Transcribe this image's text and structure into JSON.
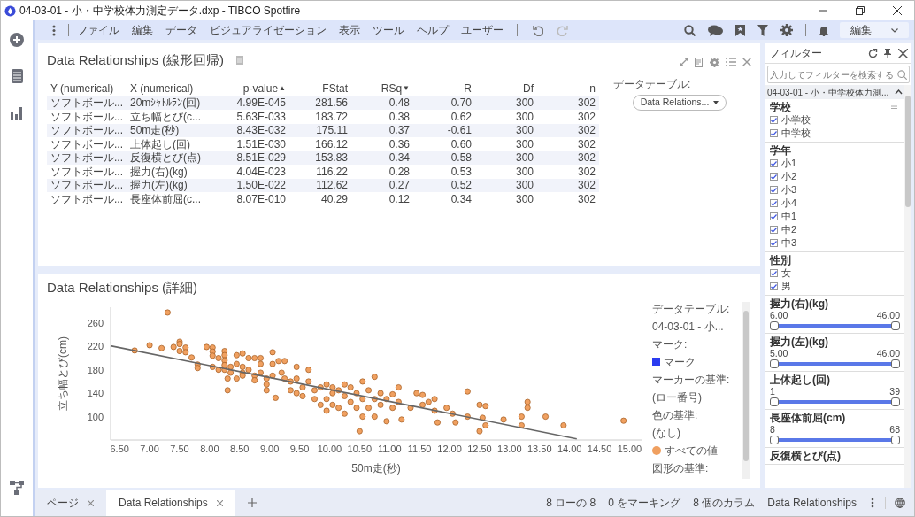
{
  "window": {
    "title": "04-03-01 - 小・中学校体力測定データ.dxp - TIBCO Spotfire"
  },
  "menu": {
    "items": [
      "ファイル",
      "編集",
      "データ",
      "ビジュアライゼーション",
      "表示",
      "ツール",
      "ヘルプ",
      "ユーザー"
    ],
    "mode": "編集"
  },
  "table_panel": {
    "title": "Data Relationships (線形回帰)",
    "data_table_label": "データテーブル:",
    "data_table_value": "Data Relations...",
    "columns": [
      {
        "label": "Y (numerical)"
      },
      {
        "label": "X (numerical)"
      },
      {
        "label": "p-value",
        "sort_mark": "▲"
      },
      {
        "label": "FStat"
      },
      {
        "label": "RSq",
        "sort_mark": "▼"
      },
      {
        "label": "R"
      },
      {
        "label": "Df"
      },
      {
        "label": "n"
      }
    ],
    "rows": [
      [
        "ソフトボール...",
        "20mｼｬﾄﾙﾗﾝ(回)",
        "4.99E-045",
        "281.56",
        "0.48",
        "0.70",
        "300",
        "302"
      ],
      [
        "ソフトボール...",
        "立ち幅とび(c...",
        "5.63E-033",
        "183.72",
        "0.38",
        "0.62",
        "300",
        "302"
      ],
      [
        "ソフトボール...",
        "50m走(秒)",
        "8.43E-032",
        "175.11",
        "0.37",
        "-0.61",
        "300",
        "302"
      ],
      [
        "ソフトボール...",
        "上体起し(回)",
        "1.51E-030",
        "166.12",
        "0.36",
        "0.60",
        "300",
        "302"
      ],
      [
        "ソフトボール...",
        "反復横とび(点)",
        "8.51E-029",
        "153.83",
        "0.34",
        "0.58",
        "300",
        "302"
      ],
      [
        "ソフトボール...",
        "握力(右)(kg)",
        "4.04E-023",
        "116.22",
        "0.28",
        "0.53",
        "300",
        "302"
      ],
      [
        "ソフトボール...",
        "握力(左)(kg)",
        "1.50E-022",
        "112.62",
        "0.27",
        "0.52",
        "300",
        "302"
      ],
      [
        "ソフトボール...",
        "長座体前屈(c...",
        "8.07E-010",
        "40.29",
        "0.12",
        "0.34",
        "300",
        "302"
      ]
    ]
  },
  "chart_panel": {
    "title": "Data Relationships (詳細)",
    "chart_data": {
      "type": "scatter",
      "xlabel": "50m走(秒)",
      "ylabel": "立ち幅とび(cm)",
      "xlim": [
        6.35,
        15.2
      ],
      "ylim": [
        60,
        287
      ],
      "xticks": [
        {
          "value": 6.5,
          "label": "6.50"
        },
        {
          "value": 7,
          "label": "7.00"
        },
        {
          "value": 7.5,
          "label": "7.50"
        },
        {
          "value": 8,
          "label": "8.00"
        },
        {
          "value": 8.5,
          "label": "8.50"
        },
        {
          "value": 9,
          "label": "9.00"
        },
        {
          "value": 9.5,
          "label": "9.50"
        },
        {
          "value": 10,
          "label": "10.00"
        },
        {
          "value": 10.5,
          "label": "10.50"
        },
        {
          "value": 11,
          "label": "11.00"
        },
        {
          "value": 11.5,
          "label": "11.50"
        },
        {
          "value": 12,
          "label": "12.00"
        },
        {
          "value": 12.5,
          "label": "12.50"
        },
        {
          "value": 13,
          "label": "13.00"
        },
        {
          "value": 13.5,
          "label": "13.50"
        },
        {
          "value": 14,
          "label": "14.00"
        },
        {
          "value": 14.5,
          "label": "14.50"
        },
        {
          "value": 15,
          "label": "15.00"
        }
      ],
      "yticks": [
        100,
        140,
        180,
        220,
        260
      ],
      "x": [
        6.75,
        7.0,
        7.2,
        7.3,
        7.4,
        7.5,
        7.5,
        7.5,
        7.6,
        7.6,
        7.7,
        7.8,
        7.8,
        7.95,
        8.05,
        8.05,
        8.05,
        8.05,
        8.15,
        8.15,
        8.25,
        8.25,
        8.25,
        8.25,
        8.25,
        8.3,
        8.3,
        8.35,
        8.35,
        8.45,
        8.45,
        8.45,
        8.55,
        8.55,
        8.55,
        8.55,
        8.65,
        8.65,
        8.75,
        8.75,
        8.75,
        8.85,
        8.85,
        8.85,
        8.95,
        8.95,
        8.95,
        9.05,
        9.05,
        9.05,
        9.1,
        9.15,
        9.2,
        9.25,
        9.25,
        9.35,
        9.35,
        9.45,
        9.45,
        9.45,
        9.55,
        9.55,
        9.65,
        9.65,
        9.75,
        9.75,
        9.85,
        9.85,
        9.95,
        9.95,
        9.95,
        10.05,
        10.05,
        10.05,
        10.15,
        10.15,
        10.25,
        10.25,
        10.25,
        10.35,
        10.35,
        10.45,
        10.45,
        10.5,
        10.55,
        10.55,
        10.55,
        10.65,
        10.65,
        10.75,
        10.75,
        10.75,
        10.85,
        10.85,
        10.95,
        10.95,
        11.05,
        11.05,
        11.15,
        11.15,
        11.2,
        11.35,
        11.45,
        11.55,
        11.55,
        11.65,
        11.75,
        11.75,
        11.8,
        11.95,
        12.05,
        12.1,
        12.3,
        12.3,
        12.5,
        12.5,
        12.55,
        12.6,
        12.6,
        12.9,
        13.2,
        13.2,
        13.3,
        13.3,
        13.6,
        13.9,
        14.9,
        6.35,
        14.12
      ],
      "series": [
        {
          "name": "すべての値",
          "color": "#f0a060",
          "values": [
            213,
            222,
            217,
            278,
            219,
            228,
            224,
            212,
            218,
            210,
            201,
            189,
            183,
            219,
            218,
            211,
            204,
            185,
            200,
            180,
            212,
            205,
            196,
            188,
            180,
            145,
            165,
            185,
            175,
            205,
            190,
            165,
            208,
            185,
            175,
            170,
            200,
            180,
            200,
            170,
            162,
            200,
            190,
            175,
            165,
            155,
            145,
            210,
            190,
            170,
            132,
            195,
            175,
            195,
            165,
            160,
            145,
            185,
            165,
            140,
            150,
            135,
            180,
            160,
            145,
            130,
            150,
            120,
            155,
            130,
            110,
            150,
            140,
            120,
            145,
            115,
            155,
            135,
            105,
            150,
            125,
            140,
            115,
            75,
            160,
            130,
            100,
            145,
            115,
            168,
            130,
            100,
            140,
            120,
            130,
            92,
            138,
            115,
            150,
            125,
            95,
            115,
            140,
            137,
            120,
            125,
            130,
            110,
            90,
            115,
            105,
            90,
            143,
            100,
            120,
            75,
            98,
            85,
            118,
            95,
            100,
            85,
            125,
            115,
            100,
            85,
            93,
            null,
            null
          ]
        },
        {
          "type": "line",
          "color": "#666666",
          "values": [
            null,
            null,
            null,
            null,
            null,
            null,
            null,
            null,
            null,
            null,
            null,
            null,
            null,
            null,
            null,
            null,
            null,
            null,
            null,
            null,
            null,
            null,
            null,
            null,
            null,
            null,
            null,
            null,
            null,
            null,
            null,
            null,
            null,
            null,
            null,
            null,
            null,
            null,
            null,
            null,
            null,
            null,
            null,
            null,
            null,
            null,
            null,
            null,
            null,
            null,
            null,
            null,
            null,
            null,
            null,
            null,
            null,
            null,
            null,
            null,
            null,
            null,
            null,
            null,
            null,
            null,
            null,
            null,
            null,
            null,
            null,
            null,
            null,
            null,
            null,
            null,
            null,
            null,
            null,
            null,
            null,
            null,
            null,
            null,
            null,
            null,
            null,
            null,
            null,
            null,
            null,
            null,
            null,
            null,
            null,
            null,
            null,
            null,
            null,
            null,
            null,
            null,
            null,
            null,
            null,
            null,
            null,
            null,
            null,
            null,
            null,
            null,
            null,
            null,
            null,
            null,
            null,
            null,
            null,
            null,
            null,
            null,
            null,
            null,
            null,
            null,
            null,
            221,
            62
          ]
        }
      ]
    },
    "legend": [
      {
        "kind": "heading",
        "text": "データテーブル:"
      },
      {
        "kind": "value",
        "text": "04-03-01 - 小..."
      },
      {
        "kind": "heading",
        "text": "マーク:"
      },
      {
        "kind": "swatch",
        "text": "マーク",
        "color": "#2b3cf0"
      },
      {
        "kind": "heading",
        "text": "マーカーの基準:"
      },
      {
        "kind": "value",
        "text": "(ロー番号)"
      },
      {
        "kind": "heading",
        "text": "色の基準:"
      },
      {
        "kind": "value",
        "text": "(なし)"
      },
      {
        "kind": "series"
      },
      {
        "kind": "heading",
        "text": "図形の基準:"
      }
    ]
  },
  "filters": {
    "title": "フィルター",
    "search_placeholder": "入力してフィルターを検索する",
    "table": "04-03-01 - 小・中学校体力測...",
    "sections": [
      {
        "kind": "checkbox",
        "title": "学校",
        "items": [
          {
            "label": "小学校",
            "checked": true
          },
          {
            "label": "中学校",
            "checked": true
          }
        ]
      },
      {
        "kind": "checkbox",
        "title": "学年",
        "items": [
          {
            "label": "小1",
            "checked": true
          },
          {
            "label": "小2",
            "checked": true
          },
          {
            "label": "小3",
            "checked": true
          },
          {
            "label": "小4",
            "checked": true
          },
          {
            "label": "中1",
            "checked": true
          },
          {
            "label": "中2",
            "checked": true
          },
          {
            "label": "中3",
            "checked": true
          }
        ]
      },
      {
        "kind": "checkbox",
        "title": "性別",
        "items": [
          {
            "label": "女",
            "checked": true
          },
          {
            "label": "男",
            "checked": true
          }
        ]
      },
      {
        "kind": "range",
        "title": "握力(右)(kg)",
        "min": "6.00",
        "max": "46.00",
        "level": 1
      },
      {
        "kind": "range",
        "title": "握力(左)(kg)",
        "min": "5.00",
        "max": "46.00",
        "level": 1
      },
      {
        "kind": "range",
        "title": "上体起し(回)",
        "min": "1",
        "max": "39",
        "level": 1
      },
      {
        "kind": "range",
        "title": "長座体前屈(cm)",
        "min": "8",
        "max": "68",
        "level": 1
      },
      {
        "kind": "title_only",
        "title": "反復横とび(点)"
      }
    ]
  },
  "tabs": [
    {
      "label": "ページ",
      "selected": false
    },
    {
      "label": "Data Relationships",
      "selected": true
    }
  ],
  "status_bar": [
    "8 ローの 8",
    "0 をマーキング",
    "8 個のカラム",
    "Data Relationships"
  ]
}
